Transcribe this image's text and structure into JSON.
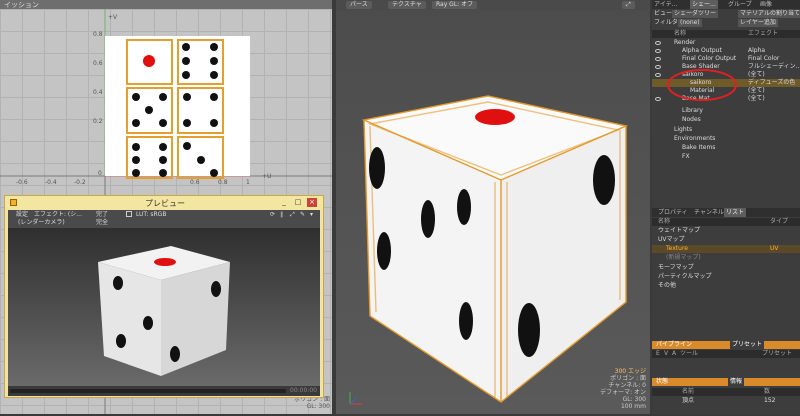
{
  "uv_editor": {
    "tab_label": "イッション",
    "axis": {
      "plus_v": "+V",
      "plus_u": "+U",
      "y_ticks": [
        "0.8",
        "0.6",
        "0.4",
        "0.2",
        "0"
      ],
      "x_ticks": [
        "-0.6",
        "-0.4",
        "-0.2",
        "0.6",
        "0.8",
        "1"
      ]
    }
  },
  "preview": {
    "title": "プレビュー",
    "toolbar": {
      "settings": "設定",
      "effect": "エフェクト: (シ...",
      "complete": "完了",
      "lut": "LUT: sRGB",
      "camera": "(レンダーカメラ)",
      "full": "完全"
    },
    "status_time": "00:00:00"
  },
  "viewport": {
    "toolbar": {
      "perspective": "パース",
      "texture": "テクスチャ",
      "raygl": "Ray GL: オフ"
    },
    "stats": {
      "edges": "300 エッジ",
      "polygon": "ポリゴン : 面",
      "channel": "チャンネル: 0",
      "deformer": "デフォーマ: オン",
      "gl": "GL: 300",
      "size": "100 mm"
    }
  },
  "left_status": {
    "polygon": "ポリゴン : 面",
    "gl": "GL: 300"
  },
  "right_panel": {
    "top_tabs": [
      "アイテ...",
      "シェー...",
      "グループ",
      "画像"
    ],
    "view_label": "ビュー",
    "view_value": "シェーダツリー",
    "material_assign": "マテリアルの割り当て",
    "filter_label": "フィルター",
    "filter_value": "(none)",
    "layer_add": "レイヤー追加",
    "tree_header": {
      "name": "名称",
      "effect": "エフェクト"
    },
    "tree": [
      {
        "label": "Render",
        "effect": ""
      },
      {
        "label": "Alpha Output",
        "effect": "Alpha"
      },
      {
        "label": "Final Color Output",
        "effect": "Final Color"
      },
      {
        "label": "Base Shader",
        "effect": "フルシェーディン..."
      },
      {
        "label": "saikoro",
        "effect": "(全て)"
      },
      {
        "label": "saikoro",
        "effect": "ディフューズの色"
      },
      {
        "label": "Material",
        "effect": "(全て)"
      },
      {
        "label": "Base Mat...",
        "effect": "(全て)"
      },
      {
        "label": "Library",
        "effect": ""
      },
      {
        "label": "Nodes",
        "effect": ""
      },
      {
        "label": "Lights",
        "effect": ""
      },
      {
        "label": "Environments",
        "effect": ""
      },
      {
        "label": "Bake Items",
        "effect": ""
      },
      {
        "label": "FX",
        "effect": ""
      }
    ],
    "mid_tabs": [
      "プロパティ",
      "チャンネル",
      "リスト"
    ],
    "list_header": {
      "name": "名称",
      "type": "タイプ"
    },
    "list": [
      {
        "label": "ウェイトマップ",
        "type": ""
      },
      {
        "label": "UVマップ",
        "type": ""
      },
      {
        "label": "Texture",
        "type": "UV"
      },
      {
        "label": "(新規マップ)",
        "type": ""
      },
      {
        "label": "モーフマップ",
        "type": ""
      },
      {
        "label": "パーティクルマップ",
        "type": ""
      },
      {
        "label": "その他",
        "type": ""
      }
    ],
    "pipeline_tab": "パイプライン",
    "preset_tab": "プリセット",
    "pipeline_cols": {
      "e": "E",
      "v": "V",
      "a": "A",
      "tool": "ツール",
      "preset": "プリセット"
    },
    "state_tab": "状態",
    "info_tab": "情報",
    "info_header": {
      "name": "名前",
      "count": "数"
    },
    "info_rows": [
      {
        "label": "頂点",
        "count": "152"
      }
    ]
  },
  "colors": {
    "accent_orange": "#e39a2d",
    "dice_red": "#e01010",
    "selection_red": "#e02020"
  }
}
